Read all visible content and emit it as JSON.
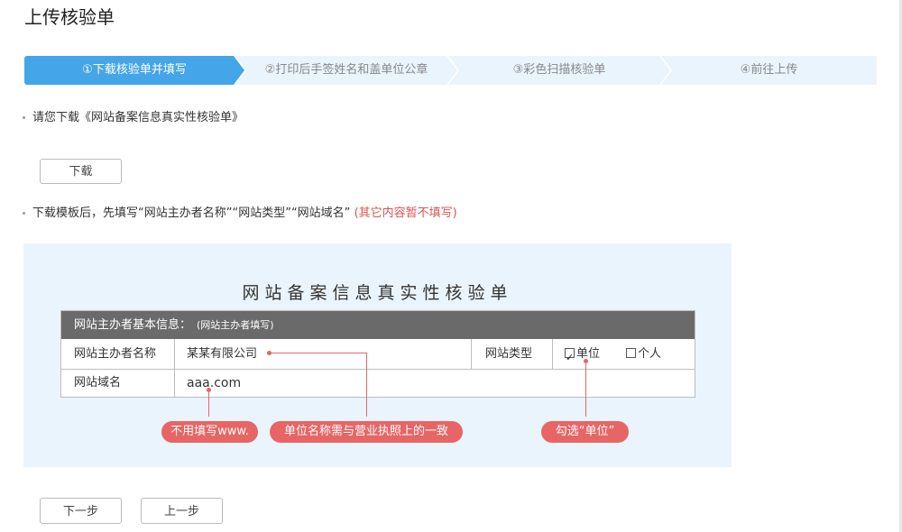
{
  "page": {
    "title": "上传核验单"
  },
  "steps": [
    {
      "label": "①下载核验单并填写",
      "active": true
    },
    {
      "label": "②打印后手签姓名和盖单位公章",
      "active": false
    },
    {
      "label": "③彩色扫描核验单",
      "active": false
    },
    {
      "label": "④前往上传",
      "active": false
    }
  ],
  "instructions": {
    "line1": "请您下载《网站备案信息真实性核验单》",
    "download_button": "下载",
    "line2": "下载模板后，先填写“网站主办者名称”“网站类型”“网站域名”",
    "line2_note": "(其它内容暂不填写)"
  },
  "sample_form": {
    "title": "网站备案信息真实性核验单",
    "section_header": "网站主办者基本信息：",
    "section_header_note": "(网站主办者填写)",
    "owner_label": "网站主办者名称",
    "owner_value": "某某有限公司",
    "type_label": "网站类型",
    "type_option_company": "单位",
    "type_option_personal": "个人",
    "domain_label": "网站域名",
    "domain_value": "aaa.com"
  },
  "callouts": {
    "domain_tip": "不用填写www.",
    "name_tip": "单位名称需与营业执照上的一致",
    "type_tip": "勾选“单位”"
  },
  "buttons": {
    "next": "下一步",
    "prev": "上一步"
  },
  "colors": {
    "accent": "#44a5e8",
    "step_bg": "#eaf4fc",
    "callout": "#e86565"
  }
}
